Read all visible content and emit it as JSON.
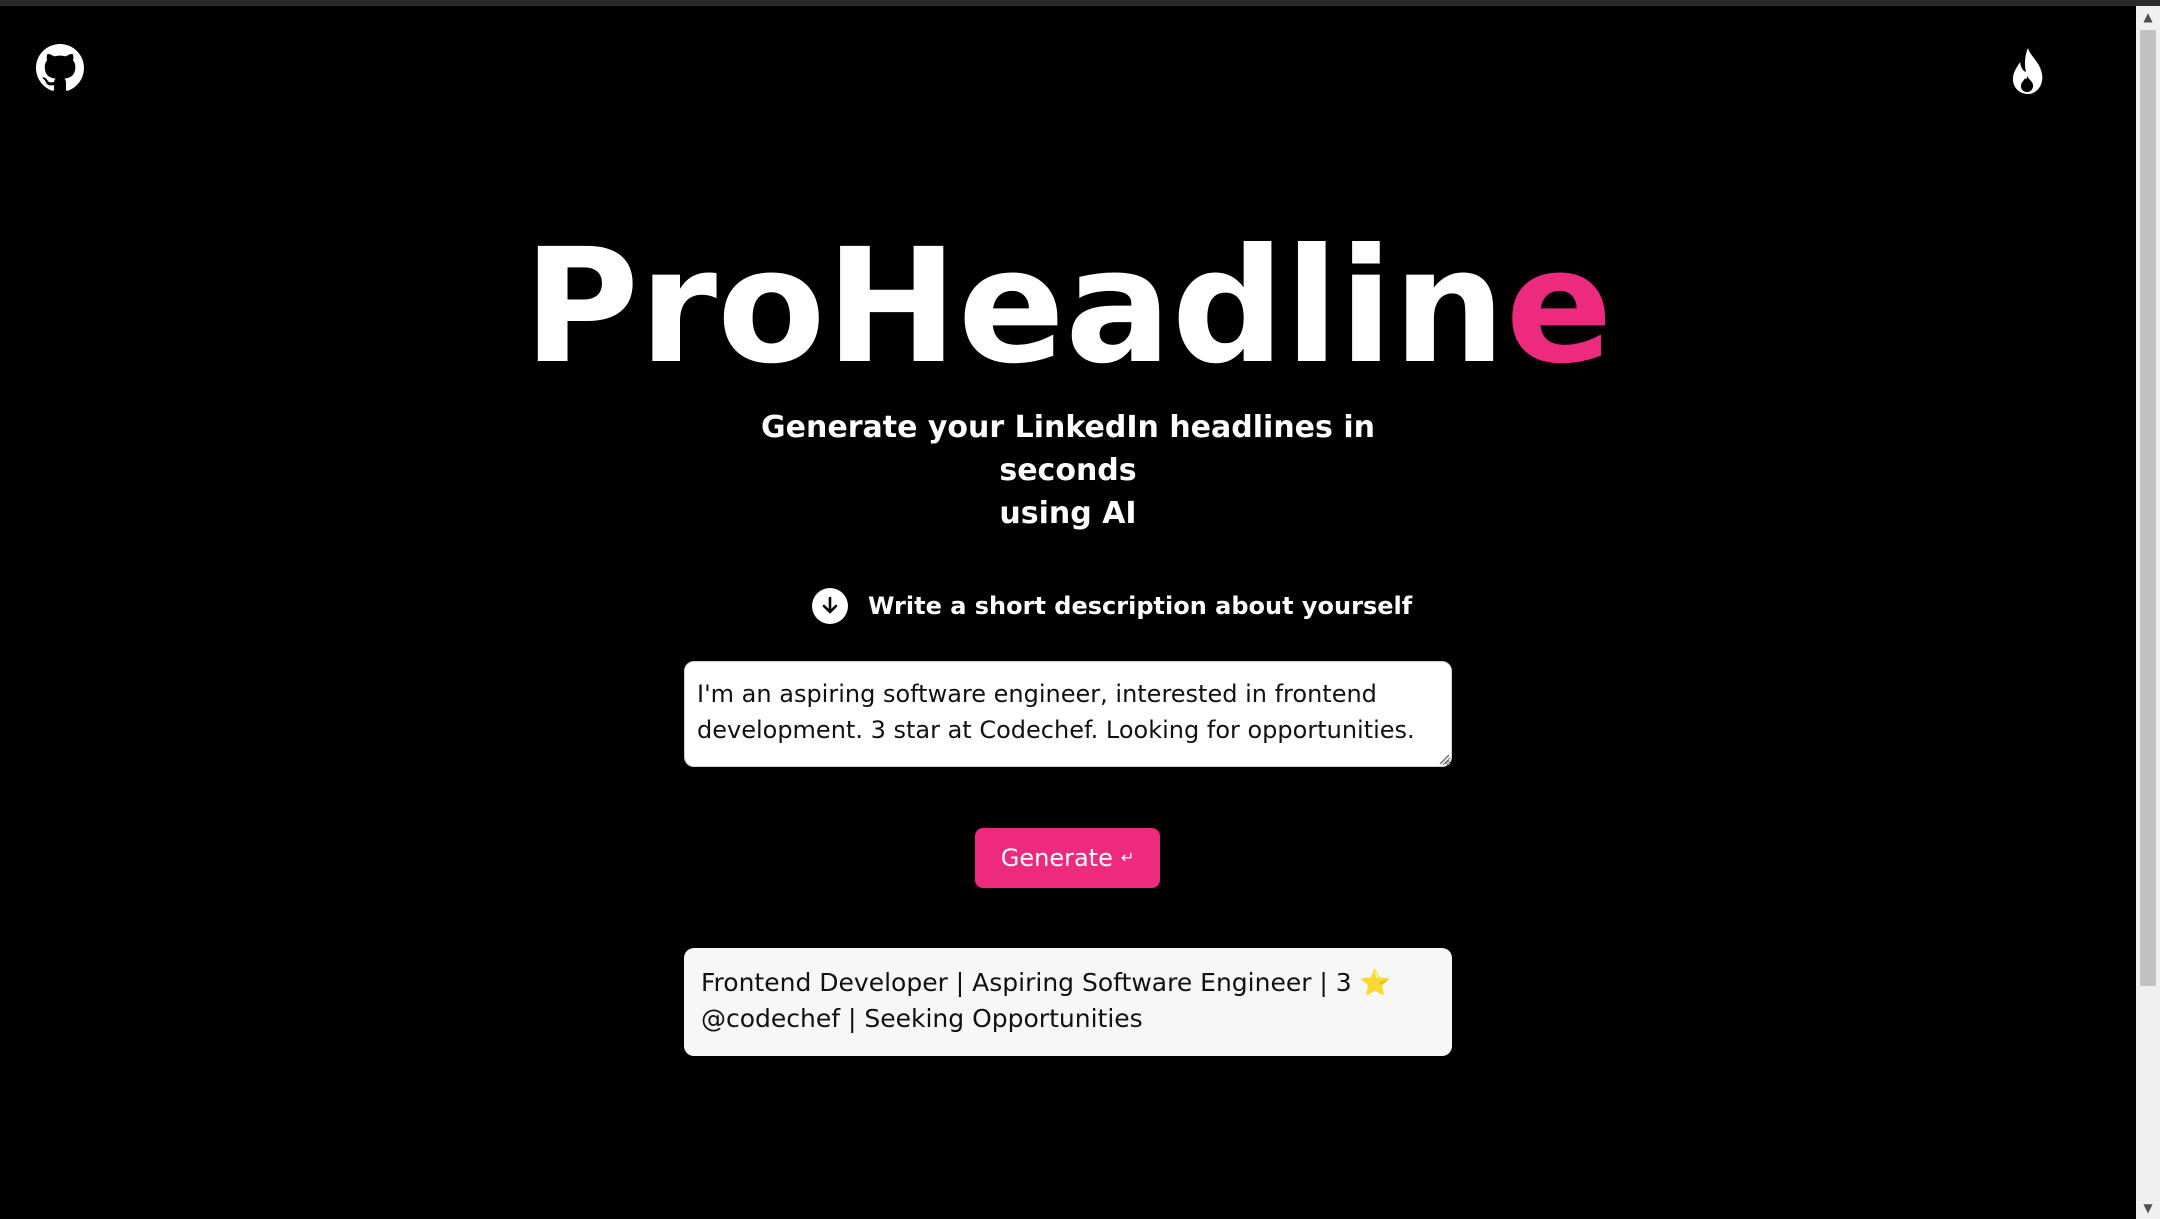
{
  "header": {
    "github_icon": "github-icon",
    "fire_icon": "fire-icon"
  },
  "hero": {
    "title_main": "ProHeadlin",
    "title_accent": "e",
    "subtitle_line1": "Generate your LinkedIn headlines in seconds",
    "subtitle_line2": "using AI"
  },
  "step": {
    "icon": "arrow-down-circle-icon",
    "label": "Write a short description about yourself"
  },
  "description": {
    "value": "I'm an aspiring software engineer, interested in frontend development. 3 star at Codechef. Looking for opportunities."
  },
  "actions": {
    "generate_label": "Generate",
    "generate_icon": "↵"
  },
  "results": [
    {
      "text_before_star": "Frontend Developer | Aspiring Software Engineer | 3",
      "star": "⭐",
      "text_after_star": "@codechef | Seeking Opportunities"
    }
  ],
  "colors": {
    "background": "#000000",
    "accent": "#ee2a7e",
    "text": "#ffffff"
  }
}
